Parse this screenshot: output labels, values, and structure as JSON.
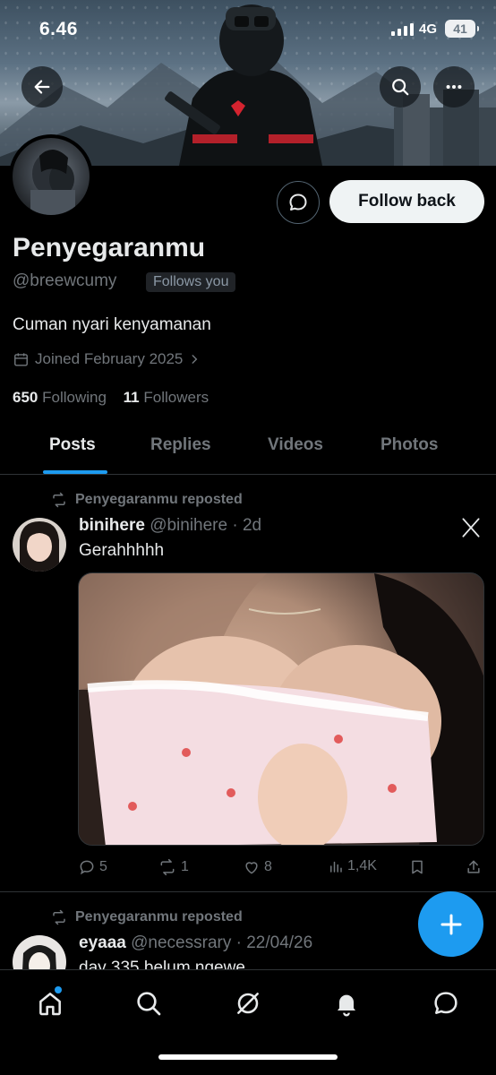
{
  "status_bar": {
    "time": "6.46",
    "network": "4G",
    "battery": "41"
  },
  "header": {
    "back_icon": "arrow-left-icon",
    "search_icon": "search-icon",
    "more_icon": "more-horizontal-icon"
  },
  "profile": {
    "display_name": "Penyegaranmu",
    "handle": "@breewcumy",
    "follows_you_badge": "Follows you",
    "bio": "Cuman nyari kenyamanan",
    "joined": "Joined February 2025",
    "following_count": "650",
    "following_label": "Following",
    "followers_count": "11",
    "followers_label": "Followers",
    "follow_button_label": "Follow back"
  },
  "tabs": [
    {
      "label": "Posts",
      "active": true
    },
    {
      "label": "Replies",
      "active": false
    },
    {
      "label": "Videos",
      "active": false
    },
    {
      "label": "Photos",
      "active": false
    }
  ],
  "posts": [
    {
      "repost_label": "Penyegaranmu reposted",
      "display_name": "binihere",
      "meta": "@binihere · 2d",
      "text": "Gerahhhhh",
      "actions": {
        "replies": "5",
        "reposts": "1",
        "likes": "8",
        "views": "1,4K"
      }
    },
    {
      "repost_label": "Penyegaranmu reposted",
      "display_name": "eyaaa",
      "meta": "@necessrary · 22/04/26",
      "text": "day 335 belum ngewe"
    }
  ],
  "colors": {
    "accent": "#1d9bf0",
    "background": "#000000",
    "secondary_text": "#71767b",
    "border": "#2f3336"
  },
  "bottom_nav": [
    {
      "name": "home-icon",
      "active": true
    },
    {
      "name": "search-icon"
    },
    {
      "name": "grok-icon"
    },
    {
      "name": "notifications-icon"
    },
    {
      "name": "messages-icon"
    }
  ]
}
